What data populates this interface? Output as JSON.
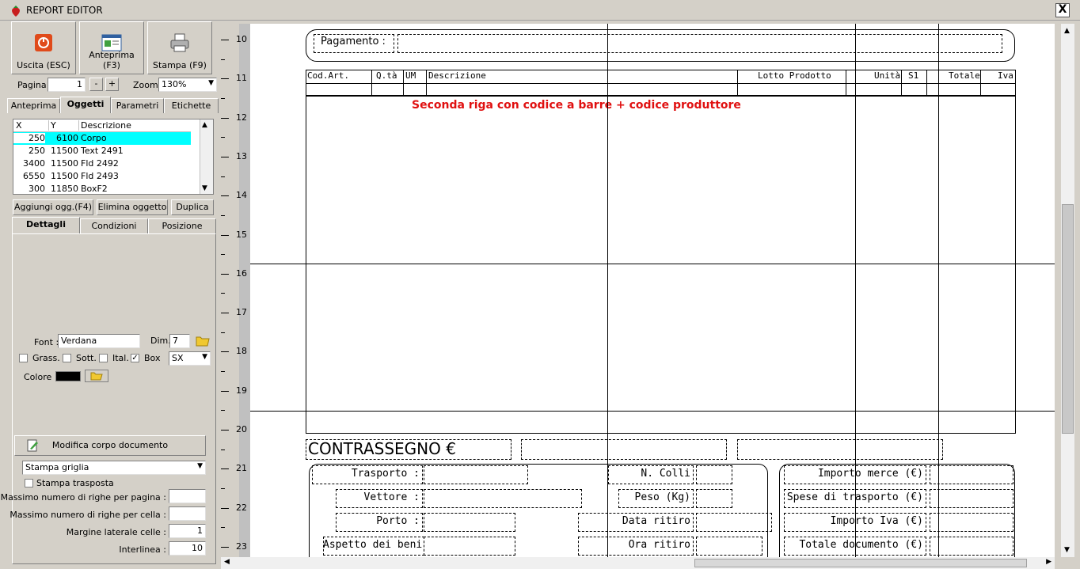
{
  "window": {
    "title": "REPORT EDITOR",
    "close_label": "X"
  },
  "toolbar": {
    "exit_label": "Uscita (ESC)",
    "preview_label": "Anteprima (F3)",
    "print_label": "Stampa (F9)"
  },
  "pager": {
    "page_label": "Pagina",
    "page_value": "1",
    "minus": "-",
    "plus": "+",
    "zoom_label": "Zoom",
    "zoom_value": "130%"
  },
  "tabs": [
    {
      "label": "Anteprima"
    },
    {
      "label": "Oggetti"
    },
    {
      "label": "Parametri"
    },
    {
      "label": "Etichette"
    }
  ],
  "objects": {
    "headers": [
      "X",
      "Y",
      "Descrizione"
    ],
    "rows": [
      [
        "250",
        "6100",
        "Corpo"
      ],
      [
        "250",
        "11500",
        "Text 2491"
      ],
      [
        "3400",
        "11500",
        "Fld 2492"
      ],
      [
        "6550",
        "11500",
        "Fld 2493"
      ],
      [
        "300",
        "11850",
        "BoxF2"
      ]
    ],
    "selected_index": 0,
    "add_label": "Aggiungi ogg.(F4)",
    "delete_label": "Elimina oggetto",
    "dup_label": "Duplica"
  },
  "subtabs": [
    {
      "label": "Dettagli"
    },
    {
      "label": "Condizioni"
    },
    {
      "label": "Posizione"
    }
  ],
  "font": {
    "font_label": "Font :",
    "font_value": "Verdana",
    "dim_label": "Dim.",
    "dim_value": "7",
    "bold_label": "Grass.",
    "underline_label": "Sott.",
    "italic_label": "Ital.",
    "box_label": "Box",
    "box_checked": "✓",
    "align_value": "SX",
    "color_label": "Colore :",
    "color_value": "#000000"
  },
  "body_opts": {
    "edit_body_label": "Modifica corpo documento",
    "print_grid_value": "Stampa griglia",
    "transposed_label": "Stampa trasposta",
    "max_rows_page_label": "Massimo numero di righe per pagina :",
    "max_rows_cell_label": "Massimo numero di righe per cella :",
    "margin_label": "Margine laterale celle :",
    "margin_value": "1",
    "line_label": "Interlinea :",
    "line_value": "10"
  },
  "ruler": {
    "marks": [
      "10",
      "11",
      "12",
      "13",
      "14",
      "15",
      "16",
      "17",
      "18",
      "19",
      "20",
      "21",
      "22",
      "23"
    ]
  },
  "canvas": {
    "payment_label": "Pagamento :",
    "columns": [
      "Cod.Art.",
      "Q.tà",
      "UM",
      "Descrizione",
      "Lotto Prodotto",
      "Unità",
      "S1",
      "Totale",
      "Iva"
    ],
    "note": "Seconda riga con codice a barre + codice produttore",
    "cod_label": "CONTRASSEGNO €",
    "left_fields": [
      "Trasporto :",
      "Vettore :",
      "Porto :",
      "Aspetto dei beni"
    ],
    "mid_fields": [
      "N. Colli",
      "Peso (Kg)",
      "Data ritiro",
      "Ora ritiro"
    ],
    "right_fields": [
      "Importo merce (€)",
      "Spese di trasporto (€)",
      "Importo Iva (€)",
      "Totale documento (€)"
    ],
    "note_color": "#e01010"
  }
}
